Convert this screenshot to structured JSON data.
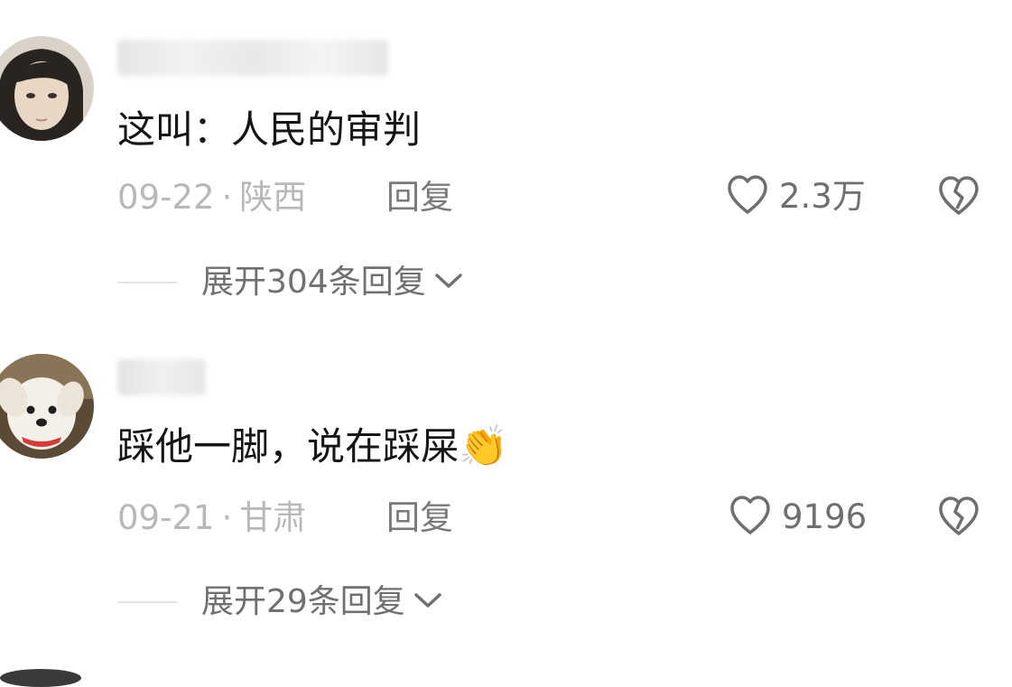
{
  "comments": [
    {
      "text": "这叫：人民的审判",
      "date": "09-22",
      "separator": "·",
      "location": "陕西",
      "reply_label": "回复",
      "like_count": "2.3万",
      "expand_label": "展开304条回复",
      "icons": {
        "like": "heart-outline-icon",
        "dislike": "broken-heart-icon",
        "expand": "chevron-down-icon"
      }
    },
    {
      "text": "踩他一脚，说在踩屎",
      "emoji": "👏",
      "date": "09-21",
      "separator": "·",
      "location": "甘肃",
      "reply_label": "回复",
      "like_count": "9196",
      "expand_label": "展开29条回复",
      "icons": {
        "like": "heart-outline-icon",
        "dislike": "broken-heart-icon",
        "expand": "chevron-down-icon"
      }
    }
  ],
  "colors": {
    "text_primary": "#161616",
    "meta_gray": "#b8b8b8",
    "action_gray": "#7a7a7a",
    "divider": "#e4e4e4"
  }
}
